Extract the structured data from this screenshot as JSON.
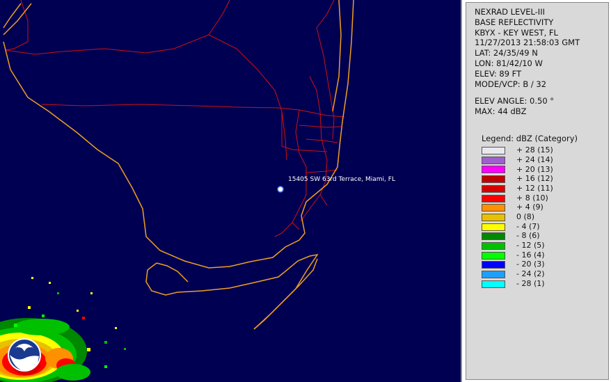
{
  "map": {
    "location_label": "15405 SW 63rd Terrace, Miami, FL",
    "background_color": "#000052",
    "coast_color": "#f0a020",
    "road_color": "#d01010",
    "logo": "NOAA"
  },
  "info": {
    "lines": [
      "NEXRAD LEVEL-III",
      "BASE REFLECTIVITY",
      "KBYX - KEY WEST, FL",
      "11/27/2013 21:58:03 GMT",
      "LAT: 24/35/49 N",
      "LON: 81/42/10 W",
      "ELEV: 89 FT",
      "MODE/VCP: B / 32"
    ],
    "elev_angle": "ELEV ANGLE: 0.50 °",
    "max": "MAX: 44 dBZ"
  },
  "legend": {
    "title": "Legend: dBZ (Category)",
    "items": [
      {
        "label": "+ 28  (15)",
        "color": "#e8e8ee"
      },
      {
        "label": "+ 24  (14)",
        "color": "#9f5fcf"
      },
      {
        "label": "+ 20  (13)",
        "color": "#ff00ff"
      },
      {
        "label": "+ 16  (12)",
        "color": "#c00000"
      },
      {
        "label": "+ 12  (11)",
        "color": "#d80000"
      },
      {
        "label": "+ 8  (10)",
        "color": "#ff0000"
      },
      {
        "label": "+ 4  (9)",
        "color": "#ff9000"
      },
      {
        "label": "0  (8)",
        "color": "#e8c000"
      },
      {
        "label": "- 4  (7)",
        "color": "#ffff00"
      },
      {
        "label": "- 8  (6)",
        "color": "#008800"
      },
      {
        "label": "- 12  (5)",
        "color": "#00c000"
      },
      {
        "label": "- 16  (4)",
        "color": "#00ff00"
      },
      {
        "label": "- 20  (3)",
        "color": "#0000ff"
      },
      {
        "label": "- 24  (2)",
        "color": "#1e9fff"
      },
      {
        "label": "- 28  (1)",
        "color": "#00ffff"
      }
    ]
  }
}
